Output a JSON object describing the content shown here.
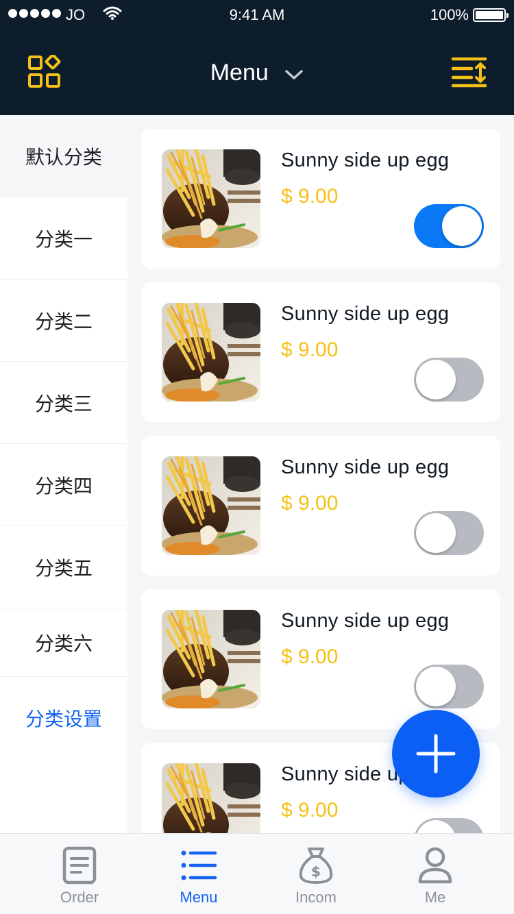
{
  "status_bar": {
    "carrier": "JO",
    "time": "9:41 AM",
    "battery": "100%"
  },
  "nav": {
    "title": "Menu"
  },
  "sidebar": {
    "items": [
      {
        "label": "默认分类"
      },
      {
        "label": "分类一"
      },
      {
        "label": "分类二"
      },
      {
        "label": "分类三"
      },
      {
        "label": "分类四"
      },
      {
        "label": "分类五"
      },
      {
        "label": "分类六"
      }
    ],
    "settings_label": "分类设置"
  },
  "dishes": [
    {
      "name": "Sunny side up egg",
      "price": "$ 9.00",
      "enabled": true
    },
    {
      "name": "Sunny side up egg",
      "price": "$ 9.00",
      "enabled": false
    },
    {
      "name": "Sunny side up egg",
      "price": "$ 9.00",
      "enabled": false
    },
    {
      "name": "Sunny side up egg",
      "price": "$ 9.00",
      "enabled": false
    },
    {
      "name": "Sunny side up egg",
      "price": "$ 9.00",
      "enabled": false
    }
  ],
  "tabs": [
    {
      "label": "Order",
      "icon": "document-icon"
    },
    {
      "label": "Menu",
      "icon": "list-icon"
    },
    {
      "label": "Incom",
      "icon": "money-bag-icon"
    },
    {
      "label": "Me",
      "icon": "person-icon"
    }
  ],
  "active_tab": "Menu",
  "colors": {
    "header_bg": "#0e1d2c",
    "accent_yellow": "#f5c117",
    "primary_blue": "#1464f0",
    "toggle_on": "#0b78f5",
    "toggle_off": "#b7bbc1"
  }
}
